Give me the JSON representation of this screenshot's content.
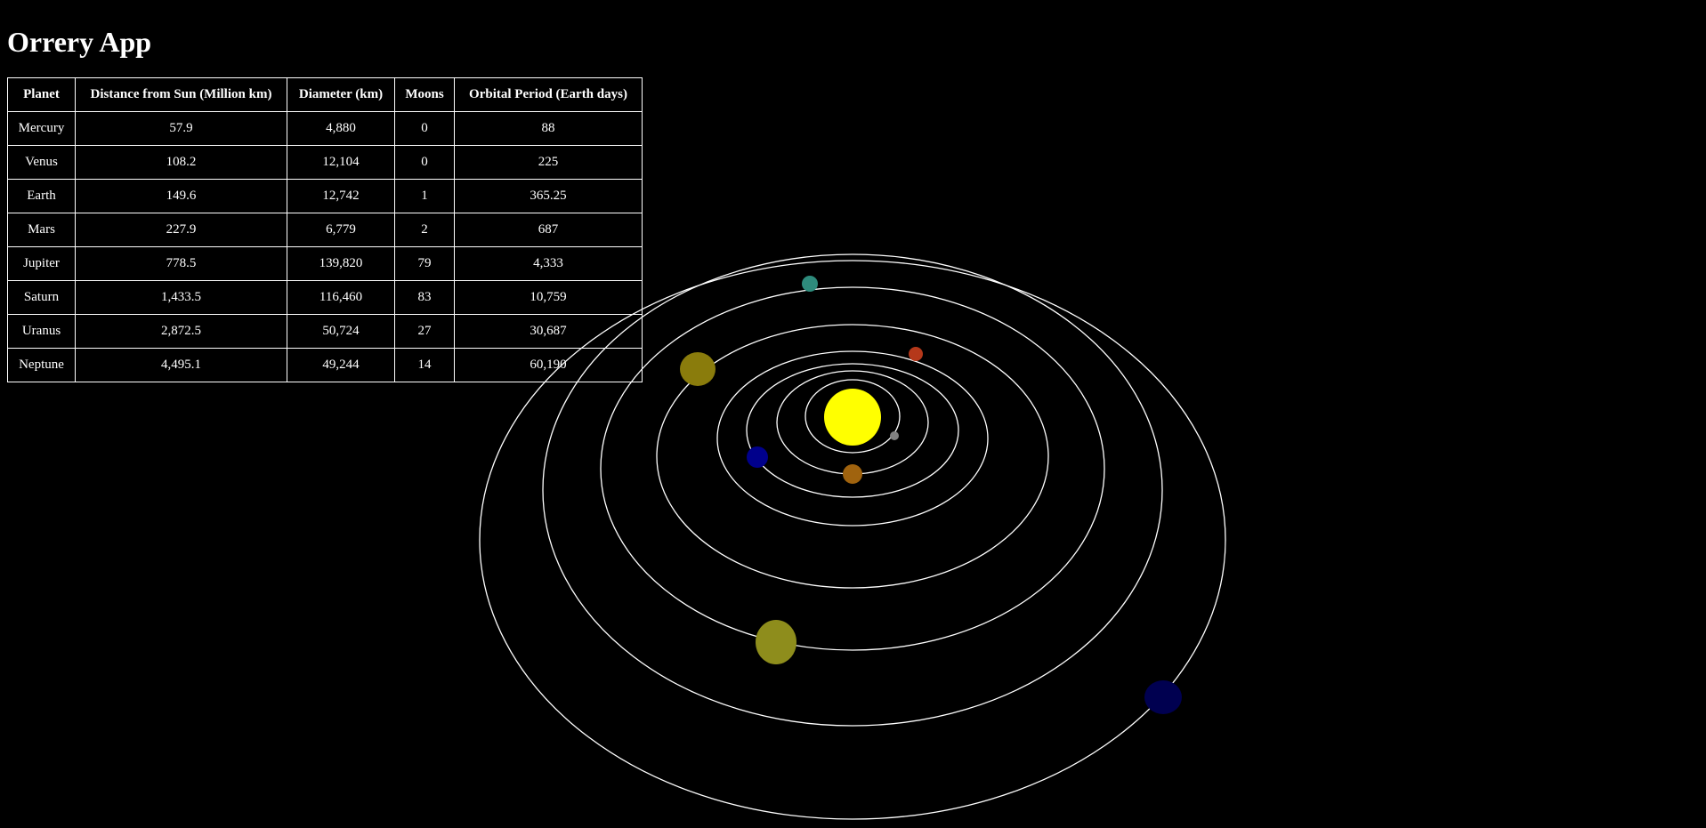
{
  "app": {
    "title": "Orrery App"
  },
  "table": {
    "headers": {
      "planet": "Planet",
      "distance": "Distance from Sun (Million km)",
      "diameter": "Diameter (km)",
      "moons": "Moons",
      "period": "Orbital Period (Earth days)"
    },
    "rows": [
      {
        "planet": "Mercury",
        "distance": "57.9",
        "diameter": "4,880",
        "moons": "0",
        "period": "88"
      },
      {
        "planet": "Venus",
        "distance": "108.2",
        "diameter": "12,104",
        "moons": "0",
        "period": "225"
      },
      {
        "planet": "Earth",
        "distance": "149.6",
        "diameter": "12,742",
        "moons": "1",
        "period": "365.25"
      },
      {
        "planet": "Mars",
        "distance": "227.9",
        "diameter": "6,779",
        "moons": "2",
        "period": "687"
      },
      {
        "planet": "Jupiter",
        "distance": "778.5",
        "diameter": "139,820",
        "moons": "79",
        "period": "4,333"
      },
      {
        "planet": "Saturn",
        "distance": "1,433.5",
        "diameter": "116,460",
        "moons": "83",
        "period": "10,759"
      },
      {
        "planet": "Uranus",
        "distance": "2,872.5",
        "diameter": "50,724",
        "moons": "27",
        "period": "30,687"
      },
      {
        "planet": "Neptune",
        "distance": "4,495.1",
        "diameter": "49,244",
        "moons": "14",
        "period": "60,190"
      }
    ]
  },
  "orrery": {
    "sun_color": "#ffff00",
    "orbit_color": "#ffffff",
    "background_color": "#000000",
    "planet_colors": {
      "mercury": "#808080",
      "venus": "#a0630e",
      "earth": "#00008b",
      "mars": "#b5381a",
      "jupiter": "#8a7c0c",
      "saturn": "#8e8d1c",
      "uranus": "#2e8b7c",
      "neptune": "#000050"
    }
  }
}
